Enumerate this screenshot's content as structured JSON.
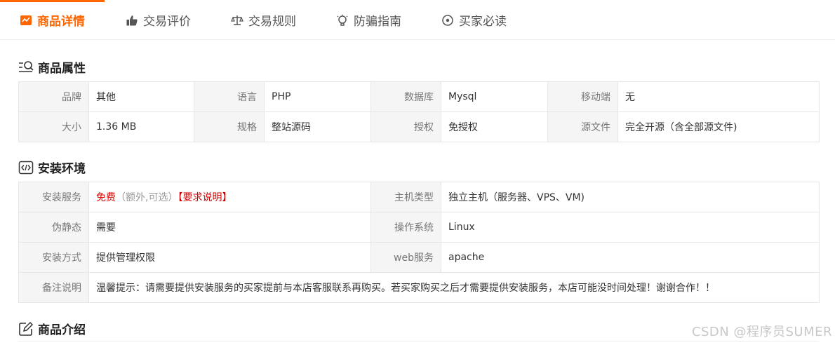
{
  "tabs": [
    {
      "label": "商品详情",
      "icon": "doc-icon",
      "active": true
    },
    {
      "label": "交易评价",
      "icon": "thumbs-up-icon",
      "active": false
    },
    {
      "label": "交易规则",
      "icon": "scales-icon",
      "active": false
    },
    {
      "label": "防骗指南",
      "icon": "bulb-icon",
      "active": false
    },
    {
      "label": "买家必读",
      "icon": "target-icon",
      "active": false
    }
  ],
  "attrs": {
    "title": "商品属性",
    "rows": [
      [
        {
          "k": "品牌",
          "v": "其他"
        },
        {
          "k": "语言",
          "v": "PHP"
        },
        {
          "k": "数据库",
          "v": "Mysql"
        },
        {
          "k": "移动端",
          "v": "无"
        }
      ],
      [
        {
          "k": "大小",
          "v": "1.36 MB"
        },
        {
          "k": "规格",
          "v": "整站源码"
        },
        {
          "k": "授权",
          "v": "免授权"
        },
        {
          "k": "源文件",
          "v": "完全开源（含全部源文件)"
        }
      ]
    ]
  },
  "install": {
    "title": "安装环境",
    "service_label": "安装服务",
    "service_free": "免费",
    "service_extra": "（额外,可选）",
    "service_link": "【要求说明】",
    "host_label": "主机类型",
    "host_value": "独立主机（服务器、VPS、VM)",
    "pseudo_label": "伪静态",
    "pseudo_value": "需要",
    "os_label": "操作系统",
    "os_value": "Linux",
    "method_label": "安装方式",
    "method_value": "提供管理权限",
    "web_label": "web服务",
    "web_value": "apache",
    "note_label": "备注说明",
    "note_value": "温馨提示：请需要提供安装服务的买家提前与本店客服联系再购买。若买家购买之后才需要提供安装服务，本店可能没时间处理！谢谢合作！！"
  },
  "intro": {
    "title": "商品介绍"
  },
  "watermark": "CSDN @程序员SUMER",
  "colors": {
    "accent": "#ff6600",
    "free": "#e60000"
  }
}
